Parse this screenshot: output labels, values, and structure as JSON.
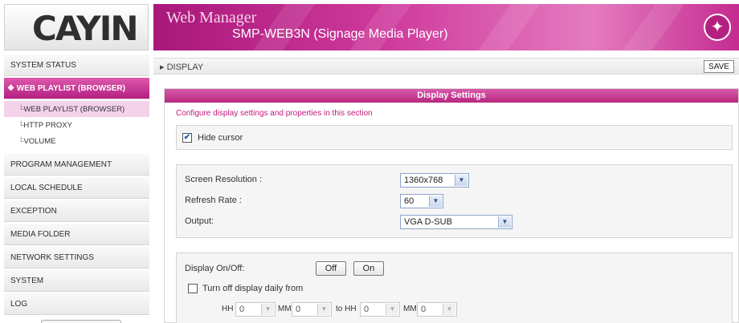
{
  "header": {
    "logo": "CAYIN",
    "app_title": "Web Manager",
    "device": "SMP-WEB3N (Signage Media Player)",
    "icon": "star-magic-icon"
  },
  "sidebar": {
    "items": [
      {
        "label": "SYSTEM STATUS"
      },
      {
        "label": "WEB PLAYLIST (BROWSER)",
        "active": true
      },
      {
        "label": "PROGRAM MANAGEMENT"
      },
      {
        "label": "LOCAL SCHEDULE"
      },
      {
        "label": "EXCEPTION"
      },
      {
        "label": "MEDIA FOLDER"
      },
      {
        "label": "NETWORK SETTINGS"
      },
      {
        "label": "SYSTEM"
      },
      {
        "label": "LOG"
      }
    ],
    "subitems": [
      {
        "label": "WEB PLAYLIST (BROWSER)",
        "selected": true
      },
      {
        "label": "HTTP PROXY"
      },
      {
        "label": "VOLUME"
      }
    ]
  },
  "toolbar": {
    "breadcrumb": "DISPLAY",
    "save_label": "SAVE"
  },
  "display_settings": {
    "title": "Display Settings",
    "description": "Configure display settings and properties in this section",
    "hide_cursor": {
      "label": "Hide cursor",
      "checked": true
    },
    "screen_resolution": {
      "label": "Screen Resolution :",
      "value": "1360x768"
    },
    "refresh_rate": {
      "label": "Refresh Rate :",
      "value": "60"
    },
    "output": {
      "label": "Output:",
      "value": "VGA D-SUB"
    },
    "display_onoff": {
      "label": "Display On/Off:",
      "off_label": "Off",
      "on_label": "On"
    },
    "turn_off_daily": {
      "label": "Turn off display daily from",
      "checked": false,
      "hh_label": "HH",
      "mm_label": "MM",
      "to_label": "to HH",
      "from_hh": "0",
      "from_mm": "0",
      "to_hh": "0",
      "to_mm": "0"
    }
  },
  "colors": {
    "brand_magenta": "#c52b90",
    "description_text": "#c2187c"
  }
}
